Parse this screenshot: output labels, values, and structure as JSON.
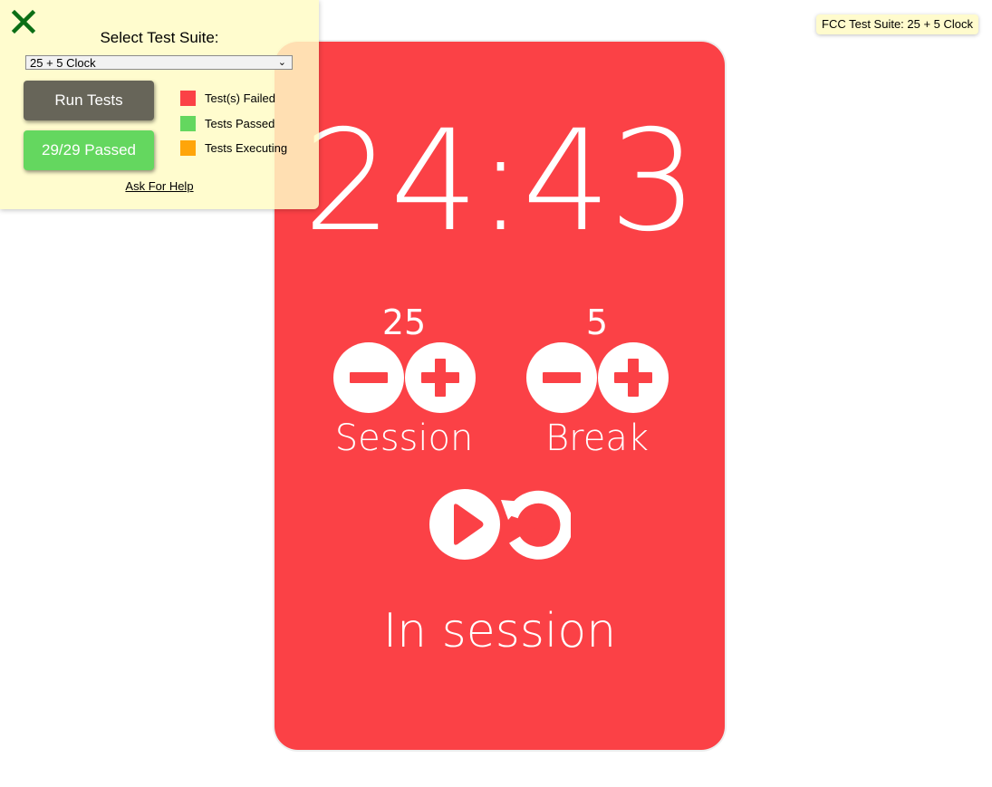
{
  "clock": {
    "time_left": "24:43",
    "session": {
      "value": "25",
      "label": "Session"
    },
    "break": {
      "value": "5",
      "label": "Break"
    },
    "timer_label": "In session",
    "colors": {
      "card": "#fb4146",
      "foreground": "#ffffff"
    },
    "icons": {
      "decrement": "minus-icon",
      "increment": "plus-icon",
      "start_stop": "play-icon",
      "reset": "history-icon"
    }
  },
  "test_suite_panel": {
    "title": "Select Test Suite:",
    "selected_suite": "25 + 5 Clock",
    "run_button_label": "Run Tests",
    "result_button_label": "29/29 Passed",
    "legend": [
      {
        "label": "Test(s) Failed",
        "color": "#fb4146"
      },
      {
        "label": "Tests Passed",
        "color": "#64d75f"
      },
      {
        "label": "Tests Executing",
        "color": "#ffa50a"
      }
    ],
    "help_link": "Ask For Help",
    "close_icon": "close-icon"
  },
  "badge": {
    "label": "FCC Test Suite: 25 + 5 Clock"
  }
}
